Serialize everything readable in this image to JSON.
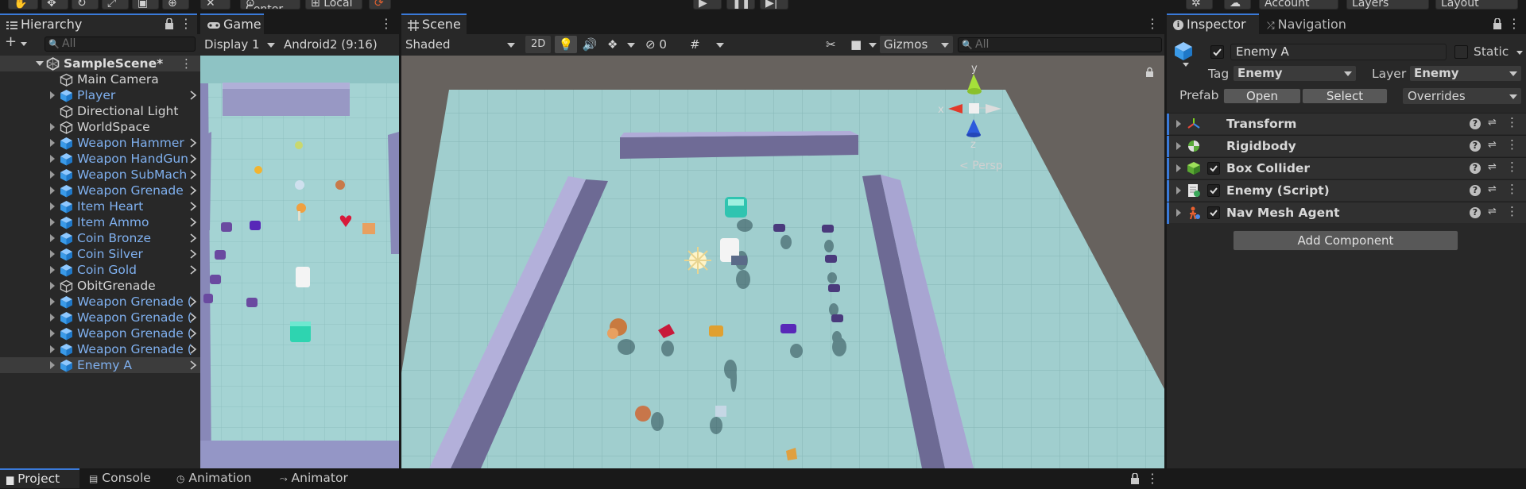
{
  "toolbar": {
    "center_label": "Center",
    "local_label": "Local",
    "account_label": "Account",
    "layers_label": "Layers",
    "layout_label": "Layout"
  },
  "hierarchy": {
    "tab_label": "Hierarchy",
    "search_placeholder": "All",
    "scene_name": "SampleScene*",
    "items": [
      {
        "label": "Main Camera",
        "color": "white",
        "prefab": false,
        "foldout": false,
        "chevron": false
      },
      {
        "label": "Player",
        "color": "blue",
        "prefab": true,
        "foldout": true,
        "chevron": true
      },
      {
        "label": "Directional Light",
        "color": "white",
        "prefab": false,
        "foldout": false,
        "chevron": false
      },
      {
        "label": "WorldSpace",
        "color": "white",
        "prefab": false,
        "foldout": true,
        "chevron": false
      },
      {
        "label": "Weapon Hammer",
        "color": "blue",
        "prefab": true,
        "foldout": true,
        "chevron": true
      },
      {
        "label": "Weapon HandGun",
        "color": "blue",
        "prefab": true,
        "foldout": true,
        "chevron": true
      },
      {
        "label": "Weapon SubMach",
        "color": "blue",
        "prefab": true,
        "foldout": true,
        "chevron": true
      },
      {
        "label": "Weapon Grenade",
        "color": "blue",
        "prefab": true,
        "foldout": true,
        "chevron": true
      },
      {
        "label": "Item Heart",
        "color": "blue",
        "prefab": true,
        "foldout": true,
        "chevron": true
      },
      {
        "label": "Item Ammo",
        "color": "blue",
        "prefab": true,
        "foldout": true,
        "chevron": true
      },
      {
        "label": "Coin Bronze",
        "color": "blue",
        "prefab": true,
        "foldout": true,
        "chevron": true
      },
      {
        "label": "Coin Silver",
        "color": "blue",
        "prefab": true,
        "foldout": true,
        "chevron": true
      },
      {
        "label": "Coin Gold",
        "color": "blue",
        "prefab": true,
        "foldout": true,
        "chevron": true
      },
      {
        "label": "ObitGrenade",
        "color": "white",
        "prefab": false,
        "foldout": true,
        "chevron": false
      },
      {
        "label": "Weapon Grenade (",
        "color": "blue",
        "prefab": true,
        "foldout": true,
        "chevron": true
      },
      {
        "label": "Weapon Grenade (",
        "color": "blue",
        "prefab": true,
        "foldout": true,
        "chevron": true
      },
      {
        "label": "Weapon Grenade (",
        "color": "blue",
        "prefab": true,
        "foldout": true,
        "chevron": true
      },
      {
        "label": "Weapon Grenade (",
        "color": "blue",
        "prefab": true,
        "foldout": true,
        "chevron": true
      },
      {
        "label": "Enemy A",
        "color": "blue",
        "prefab": true,
        "foldout": true,
        "chevron": true,
        "selected": true
      }
    ]
  },
  "game": {
    "tab_label": "Game",
    "display": "Display 1",
    "resolution": "Android2 (9:16)"
  },
  "scene": {
    "tab_label": "Scene",
    "draw_mode": "Shaded",
    "toggle_2d": "2D",
    "hidden_count": "0",
    "gizmos_label": "Gizmos",
    "search_placeholder": "All",
    "gizmo_axes": {
      "x": "x",
      "y": "y",
      "z": "z"
    },
    "persp_label": "Persp"
  },
  "inspector": {
    "tab_label": "Inspector",
    "nav_tab_label": "Navigation",
    "object_name": "Enemy A",
    "static_label": "Static",
    "tag_label": "Tag",
    "tag_value": "Enemy",
    "layer_label": "Layer",
    "layer_value": "Enemy",
    "prefab_label": "Prefab",
    "open_label": "Open",
    "select_label": "Select",
    "overrides_label": "Overrides",
    "components": [
      {
        "name": "Transform",
        "checkbox": false,
        "icon": "transform-icon"
      },
      {
        "name": "Rigidbody",
        "checkbox": false,
        "icon": "rigidbody-icon"
      },
      {
        "name": "Box Collider",
        "checkbox": true,
        "icon": "box-collider-icon"
      },
      {
        "name": "Enemy (Script)",
        "checkbox": true,
        "icon": "script-icon"
      },
      {
        "name": "Nav Mesh Agent",
        "checkbox": true,
        "icon": "nav-mesh-agent-icon"
      }
    ],
    "add_component_label": "Add Component"
  },
  "bottom": {
    "tabs": [
      {
        "label": "Project",
        "icon": "folder-icon"
      },
      {
        "label": "Console",
        "icon": "console-icon"
      },
      {
        "label": "Animation",
        "icon": "animation-icon"
      },
      {
        "label": "Animator",
        "icon": "animator-icon"
      }
    ]
  },
  "colors": {
    "accent": "#3a7ad9",
    "prefab_blue": "#7fb0ef",
    "floor": "#a8d4d4",
    "wall": "#8e8fb8"
  }
}
